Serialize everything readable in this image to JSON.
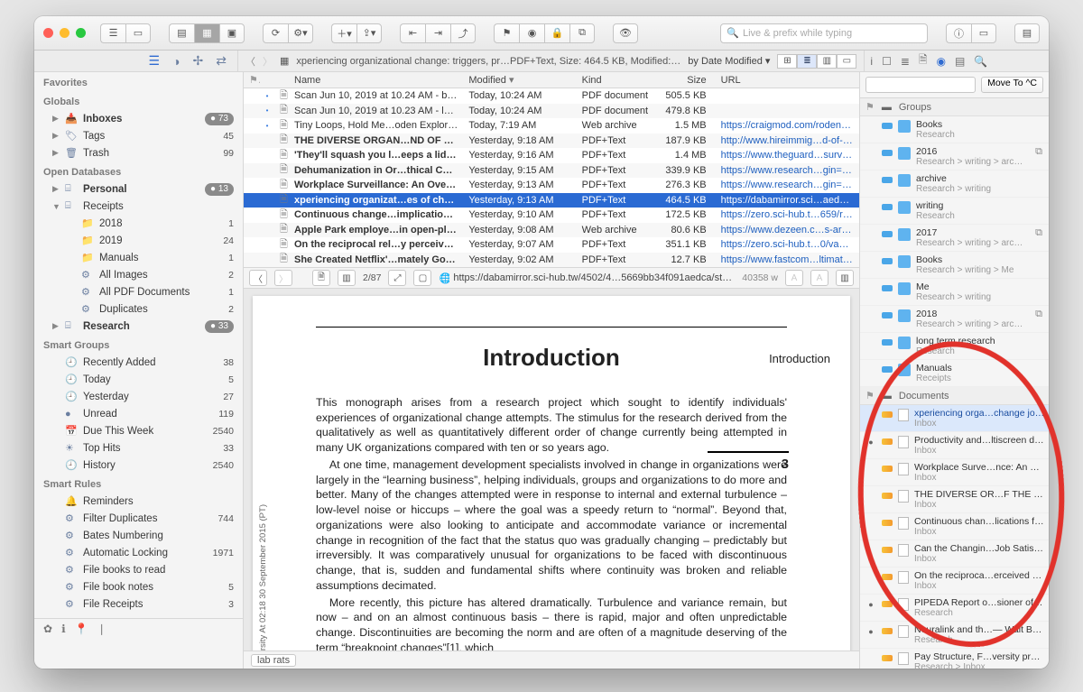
{
  "window": {
    "search_placeholder": "Live & prefix while typing",
    "breadcrumb": "xperiencing organizational change: triggers, pr…PDF+Text, Size: 464.5 KB, Modified: Jun 9, 2019",
    "sort_label": "by Date Modified"
  },
  "sidebar": {
    "sections": {
      "favorites": "Favorites",
      "globals": "Globals",
      "open_db": "Open Databases",
      "smart_groups": "Smart Groups",
      "smart_rules": "Smart Rules"
    },
    "globals": [
      {
        "icon": "inbox",
        "label": "Inboxes",
        "pill": "73",
        "caret": "▶",
        "bold": true
      },
      {
        "icon": "tag",
        "label": "Tags",
        "count": "45",
        "caret": "▶"
      },
      {
        "icon": "trash",
        "label": "Trash",
        "count": "99",
        "caret": "▶"
      }
    ],
    "databases": [
      {
        "icon": "db",
        "label": "Personal",
        "pill": "13",
        "caret": "▶",
        "bold": true
      },
      {
        "icon": "db",
        "label": "Receipts",
        "caret": "▼"
      },
      {
        "icon": "folder",
        "label": "2018",
        "count": "1",
        "sub": true
      },
      {
        "icon": "folder",
        "label": "2019",
        "count": "24",
        "sub": true
      },
      {
        "icon": "folder",
        "label": "Manuals",
        "count": "1",
        "sub": true
      },
      {
        "icon": "smart",
        "label": "All Images",
        "count": "2",
        "sub": true
      },
      {
        "icon": "smart",
        "label": "All PDF Documents",
        "count": "1",
        "sub": true
      },
      {
        "icon": "smart",
        "label": "Duplicates",
        "count": "2",
        "sub": true
      },
      {
        "icon": "db",
        "label": "Research",
        "pill": "33",
        "caret": "▶",
        "bold": true
      }
    ],
    "smart_groups": [
      {
        "icon": "clock",
        "label": "Recently Added",
        "count": "38"
      },
      {
        "icon": "clock",
        "label": "Today",
        "count": "5"
      },
      {
        "icon": "clock",
        "label": "Yesterday",
        "count": "27"
      },
      {
        "icon": "dot",
        "label": "Unread",
        "count": "119"
      },
      {
        "icon": "cal",
        "label": "Due This Week",
        "count": "2540"
      },
      {
        "icon": "star",
        "label": "Top Hits",
        "count": "33"
      },
      {
        "icon": "clock",
        "label": "History",
        "count": "2540"
      }
    ],
    "smart_rules": [
      {
        "icon": "bell",
        "label": "Reminders",
        "count": ""
      },
      {
        "icon": "gear",
        "label": "Filter Duplicates",
        "count": "744"
      },
      {
        "icon": "gear",
        "label": "Bates Numbering",
        "count": ""
      },
      {
        "icon": "gear",
        "label": "Automatic Locking",
        "count": "1971"
      },
      {
        "icon": "gear",
        "label": "File books to read",
        "count": ""
      },
      {
        "icon": "gear",
        "label": "File book notes",
        "count": "5"
      },
      {
        "icon": "gear",
        "label": "File Receipts",
        "count": "3"
      }
    ]
  },
  "list": {
    "headers": {
      "name": "Name",
      "modified": "Modified",
      "kind": "Kind",
      "size": "Size",
      "url": "URL"
    },
    "rows": [
      {
        "dot": "•",
        "name": "Scan Jun 10, 2019 at 10.24 AM - books",
        "mod": "Today, 10:24 AM",
        "kind": "PDF document",
        "size": "505.5 KB",
        "url": ""
      },
      {
        "dot": "•",
        "name": "Scan Jun 10, 2019 at 10.23 AM - lamy pen",
        "mod": "Today, 10:24 AM",
        "kind": "PDF document",
        "size": "479.8 KB",
        "url": ""
      },
      {
        "dot": "•",
        "name": "Tiny Loops, Hold Me…oden Explorers Archive",
        "mod": "Today, 7:19 AM",
        "kind": "Web archive",
        "size": "1.5 MB",
        "url": "https://craigmod.com/roden/027/"
      },
      {
        "dot": "",
        "bold": true,
        "name": "THE DIVERSE ORGAN…ND OF THE RAINBOW",
        "mod": "Yesterday, 9:18 AM",
        "kind": "PDF+Text",
        "size": "187.9 KB",
        "url": "http://www.hireimmig…d-of-the-Rainbow.pdf"
      },
      {
        "dot": "",
        "bold": true,
        "name": "'They'll squash you l…eeps a lid on leakers",
        "mod": "Yesterday, 9:16 AM",
        "kind": "PDF+Text",
        "size": "1.4 MB",
        "url": "https://www.theguard…surveillance-leakers"
      },
      {
        "dot": "",
        "bold": true,
        "name": "Dehumanization in Or…thical Considerations",
        "mod": "Yesterday, 9:15 AM",
        "kind": "PDF+Text",
        "size": "339.9 KB",
        "url": "https://www.research…gin=publication_detail"
      },
      {
        "dot": "",
        "bold": true,
        "name": "Workplace Surveillance: An Overview",
        "mod": "Yesterday, 9:13 AM",
        "kind": "PDF+Text",
        "size": "276.3 KB",
        "url": "https://www.research…gin=publication_detail"
      },
      {
        "dot": "",
        "bold": true,
        "sel": true,
        "name": "xperiencing organizat…es of change journeys",
        "mod": "Yesterday, 9:13 AM",
        "kind": "PDF+Text",
        "size": "464.5 KB",
        "url": "https://dabamirror.sci…aedca/stuart1995.pdf"
      },
      {
        "dot": "",
        "bold": true,
        "name": "Continuous change…implications for HRD",
        "mod": "Yesterday, 9:10 AM",
        "kind": "PDF+Text",
        "size": "172.5 KB",
        "url": "https://zero.sci-hub.t…659/rumbles2013.pdf"
      },
      {
        "dot": "",
        "bold": true,
        "name": "Apple Park employe…in open-plan offices",
        "mod": "Yesterday, 9:08 AM",
        "kind": "Web archive",
        "size": "80.6 KB",
        "url": "https://www.dezeen.c…s-architecture-news/"
      },
      {
        "dot": "",
        "bold": true,
        "name": "On the reciprocal rel…y perceived control?",
        "mod": "Yesterday, 9:07 AM",
        "kind": "PDF+Text",
        "size": "351.1 KB",
        "url": "https://zero.sci-hub.t…0/vanderelst2014.pdf"
      },
      {
        "dot": "",
        "bold": true,
        "name": "She Created Netflix'…mately Got Her Fired",
        "mod": "Yesterday, 9:02 AM",
        "kind": "PDF+Text",
        "size": "12.7 KB",
        "url": "https://www.fastcom…ltimately-got-her-fired"
      }
    ]
  },
  "preview": {
    "page_num": "2/87",
    "url": "https://dabamirror.sci-hub.tw/4502/4…5669bb34f091aedca/stuart1995.pdf",
    "word_count": "40358 w",
    "title": "Introduction",
    "side_label": "Introduction",
    "side_number": "3",
    "vstamp": "rsity At 02:18 30 September 2015 (PT)",
    "p1": "This monograph arises from a research project which sought to identify individuals' experiences of organizational change attempts. The stimulus for the research derived from the qualitatively as well as quantitatively different order of change currently being attempted in many UK organizations compared with ten or so years ago.",
    "p2": "At one time, management development specialists involved in change in organizations were largely in the “learning business”, helping individuals, groups and organizations to do more and better. Many of the changes attempted were in response to internal and external turbulence – low-level noise or hiccups – where the goal was a speedy return to “normal”. Beyond that, organizations were also looking to anticipate and accommodate variance or incremental change in recognition of the fact that the status quo was gradually changing – predictably but irreversibly. It was comparatively unusual for organizations to be faced with discontinuous change, that is, sudden and fundamental shifts where continuity was broken and reliable assumptions decimated.",
    "p3": "More recently, this picture has altered dramatically. Turbulence and variance remain, but now – and on an almost continuous basis – there is rapid, major and often unpredictable change. Discontinuities are becoming the norm and are often of a magnitude deserving of the term “breakpoint changes”[1], which"
  },
  "footer": {
    "tag": "lab rats"
  },
  "inspector": {
    "move_btn": "Move To ^C",
    "groups_label": "Groups",
    "documents_label": "Documents",
    "groups": [
      {
        "title": "Books",
        "path": "Research"
      },
      {
        "title": "2016",
        "path": "Research > writing > archive",
        "g": true
      },
      {
        "title": "archive",
        "path": "Research > writing"
      },
      {
        "title": "writing",
        "path": "Research"
      },
      {
        "title": "2017",
        "path": "Research > writing > archive",
        "g": true
      },
      {
        "title": "Books",
        "path": "Research > writing > Me"
      },
      {
        "title": "Me",
        "path": "Research > writing"
      },
      {
        "title": "2018",
        "path": "Research > writing > archive",
        "g": true
      },
      {
        "title": "long term research",
        "path": "Research"
      },
      {
        "title": "Manuals",
        "path": "Receipts"
      }
    ],
    "documents": [
      {
        "title": "xperiencing orga…change journeys",
        "path": "Inbox",
        "sel": true
      },
      {
        "title": "Productivity and…ltiscreen displays",
        "path": "Inbox",
        "dot": true
      },
      {
        "title": "Workplace Surve…nce: An Overview",
        "path": "Inbox"
      },
      {
        "title": "THE DIVERSE OR…F THE RAINBOW",
        "path": "Inbox"
      },
      {
        "title": "Continuous chan…lications for HRD",
        "path": "Inbox"
      },
      {
        "title": "Can the Changin…Job Satisfaction?",
        "path": "Inbox"
      },
      {
        "title": "On the reciproca…erceived control?",
        "path": "Inbox"
      },
      {
        "title": "PIPEDA Report o…sioner of Canada",
        "path": "Research",
        "dot": true
      },
      {
        "title": "Neuralink and th…— Wait But Why",
        "path": "Research",
        "dot": true
      },
      {
        "title": "Pay Structure, F…versity professors",
        "path": "Research > Inbox"
      }
    ]
  }
}
